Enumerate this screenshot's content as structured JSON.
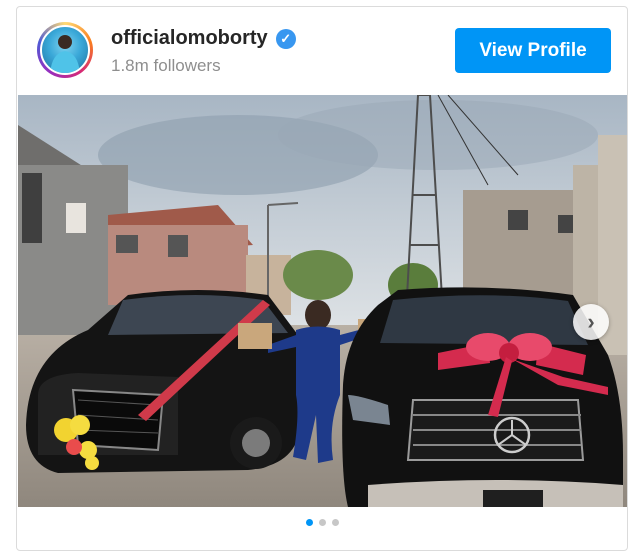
{
  "profile": {
    "username": "officialomoborty",
    "followers": "1.8m followers",
    "verified_icon": "verified-badge-icon",
    "view_profile_label": "View Profile"
  },
  "carousel": {
    "next_icon": "chevron-right-icon",
    "dot_count": 3,
    "active_index": 0
  },
  "colors": {
    "accent": "#0095f6",
    "verified": "#3897f0"
  }
}
